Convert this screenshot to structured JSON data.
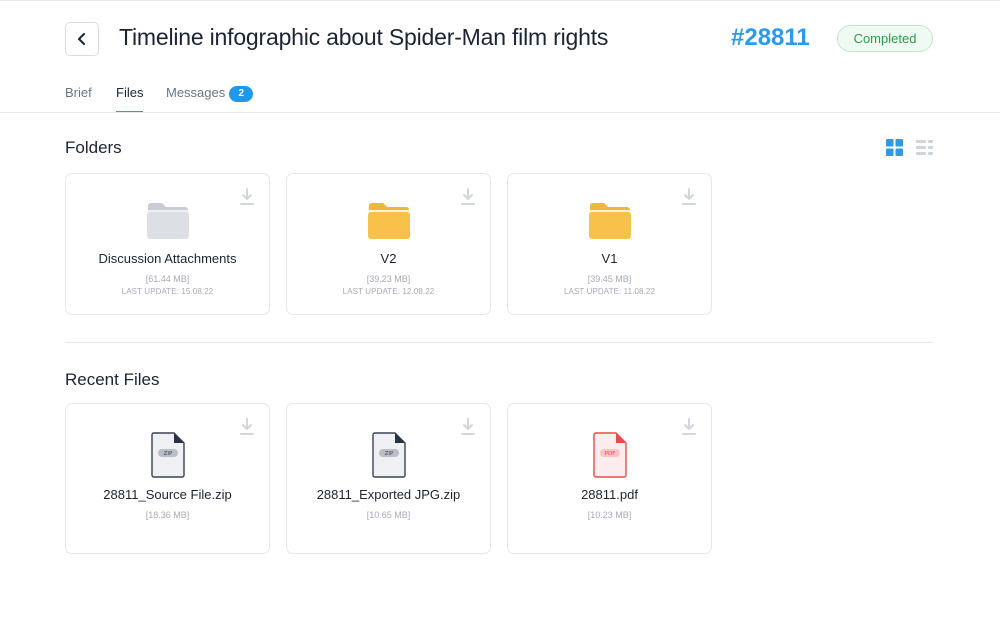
{
  "header": {
    "title": "Timeline infographic about Spider-Man film rights",
    "order_id": "#28811",
    "status": "Completed",
    "back_icon": "chevron-left-icon"
  },
  "tabs": [
    {
      "label": "Brief",
      "active": false
    },
    {
      "label": "Files",
      "active": true
    },
    {
      "label": "Messages",
      "active": false,
      "badge": "2"
    }
  ],
  "folders_section": {
    "title": "Folders",
    "view_icons": [
      "grid-view-icon",
      "list-view-icon"
    ],
    "items": [
      {
        "name": "Discussion Attachments",
        "size": "[61.44 MB]",
        "updated": "LAST UPDATE: 15.08.22",
        "color": "#c9ccd2"
      },
      {
        "name": "V2",
        "size": "[39.23 MB]",
        "updated": "LAST UPDATE: 12.08.22",
        "color": "#f7c14a"
      },
      {
        "name": "V1",
        "size": "[39.45 MB]",
        "updated": "LAST UPDATE: 11.08.22",
        "color": "#f7c14a"
      }
    ]
  },
  "recent_files_section": {
    "title": "Recent Files",
    "items": [
      {
        "name": "28811_Source File.zip",
        "size": "[18.36 MB]",
        "type": "ZIP"
      },
      {
        "name": "28811_Exported JPG.zip",
        "size": "[10.65 MB]",
        "type": "ZIP"
      },
      {
        "name": "28811.pdf",
        "size": "[10.23 MB]",
        "type": "PDF"
      }
    ]
  },
  "colors": {
    "accent": "#2b9be8",
    "status_green": "#2b9b4e",
    "pdf_red": "#e94b4b"
  }
}
